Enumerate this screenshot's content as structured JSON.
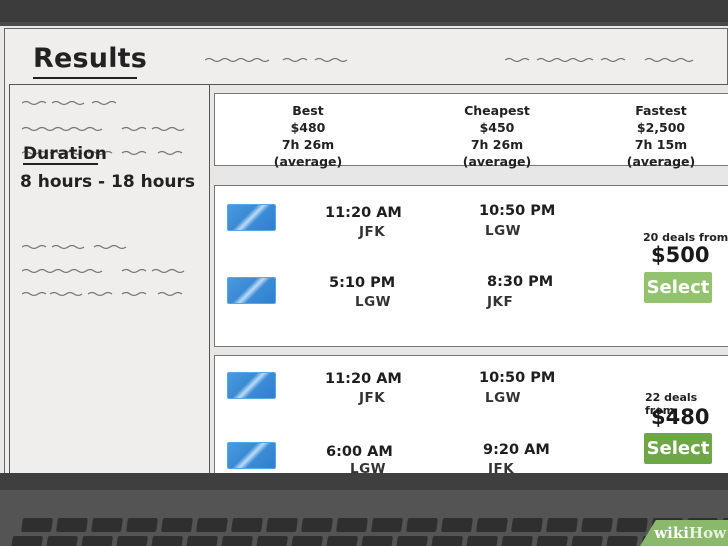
{
  "page": {
    "title": "Results"
  },
  "sidebar": {
    "duration_label": "Duration",
    "duration_value": "8 hours - 18 hours"
  },
  "summary": {
    "best": {
      "label": "Best",
      "price": "$480",
      "time": "7h 26m (average)"
    },
    "cheapest": {
      "label": "Cheapest",
      "price": "$450",
      "time": "7h 26m (average)"
    },
    "fastest": {
      "label": "Fastest",
      "price": "$2,500",
      "time": "7h 15m (average)"
    }
  },
  "results": [
    {
      "outbound": {
        "depart_time": "11:20 AM",
        "depart_code": "JFK",
        "arrive_time": "10:50 PM",
        "arrive_code": "LGW"
      },
      "return": {
        "depart_time": "5:10 PM",
        "depart_code": "LGW",
        "arrive_time": "8:30 PM",
        "arrive_code": "JKF"
      },
      "deals": "20 deals from",
      "price": "$500",
      "select_label": "Select"
    },
    {
      "outbound": {
        "depart_time": "11:20 AM",
        "depart_code": "JFK",
        "arrive_time": "10:50 PM",
        "arrive_code": "LGW"
      },
      "return": {
        "depart_time": "6:00 AM",
        "depart_code": "LGW",
        "arrive_time": "9:20 AM",
        "arrive_code": "JFK"
      },
      "deals": "22 deals from",
      "price": "$480",
      "select_label": "Select"
    }
  ],
  "watermark": {
    "part1": "wiki",
    "part2": "How"
  },
  "colors": {
    "select_button": "#93c36f",
    "select_button_active": "#6ea846",
    "airline_logo": "#3a8ad6",
    "screen_background": "#efeeec"
  },
  "icons": {
    "airline_logo": "airline-logo-icon"
  }
}
